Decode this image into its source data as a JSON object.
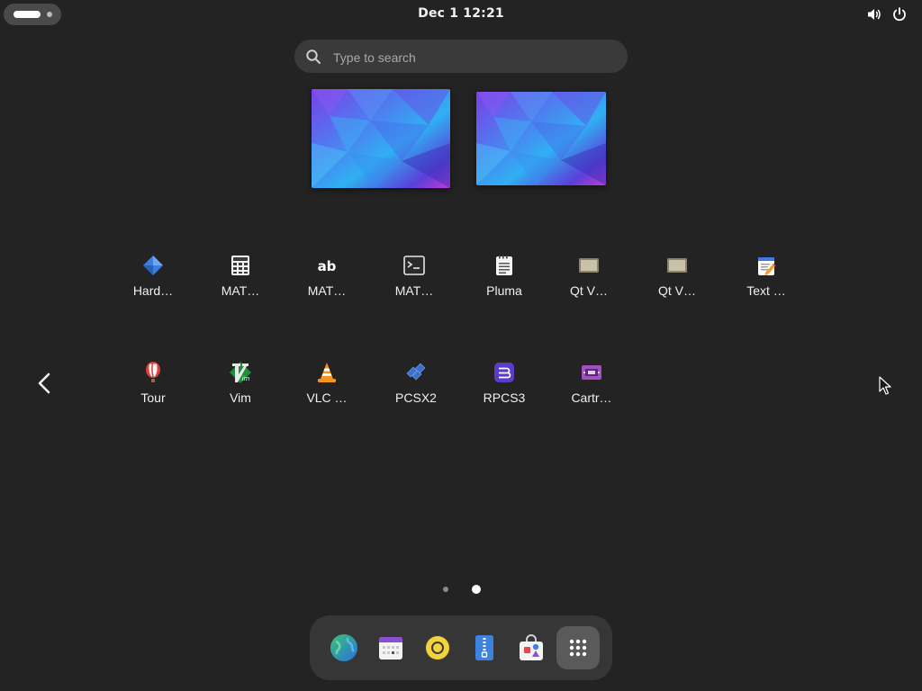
{
  "topbar": {
    "clock": "Dec 1  12:21",
    "icons": [
      "activities-indicator",
      "volume-icon",
      "power-icon"
    ]
  },
  "search": {
    "placeholder": "Type to search",
    "value": ""
  },
  "workspaces": {
    "count": 2,
    "wallpaper_colors": [
      "#6a3cf0",
      "#2fa8f2",
      "#c33ad6"
    ]
  },
  "app_grid": {
    "rows": [
      [
        {
          "label": "Hard…",
          "icon": "hardinfo-icon"
        },
        {
          "label": "MAT…",
          "icon": "calculator-icon"
        },
        {
          "label": "MAT…",
          "icon": "character-map-icon"
        },
        {
          "label": "MAT…",
          "icon": "terminal-icon"
        },
        {
          "label": "Pluma",
          "icon": "pluma-icon"
        },
        {
          "label": "Qt V…",
          "icon": "qt-folder-icon"
        },
        {
          "label": "Qt V…",
          "icon": "qt-folder-icon"
        },
        {
          "label": "Text …",
          "icon": "text-editor-icon"
        }
      ],
      [
        {
          "label": "Tour",
          "icon": "tour-balloon-icon"
        },
        {
          "label": "Vim",
          "icon": "vim-icon"
        },
        {
          "label": "VLC …",
          "icon": "vlc-icon"
        },
        {
          "label": "PCSX2",
          "icon": "pcsx2-icon"
        },
        {
          "label": "RPCS3",
          "icon": "rpcs3-icon"
        },
        {
          "label": "Cartr…",
          "icon": "cartridges-icon"
        }
      ]
    ]
  },
  "pagination": {
    "pages": 2,
    "current": 2
  },
  "dock": {
    "items": [
      {
        "name": "web-browser-icon"
      },
      {
        "name": "calendar-icon"
      },
      {
        "name": "rhythmbox-icon"
      },
      {
        "name": "file-archiver-icon"
      },
      {
        "name": "software-store-icon"
      },
      {
        "name": "show-apps-icon",
        "active": true
      }
    ]
  },
  "colors": {
    "background": "#232323",
    "search_bg": "#3a3a3a",
    "dock_bg": "#363636",
    "text": "#f2f2f2"
  }
}
